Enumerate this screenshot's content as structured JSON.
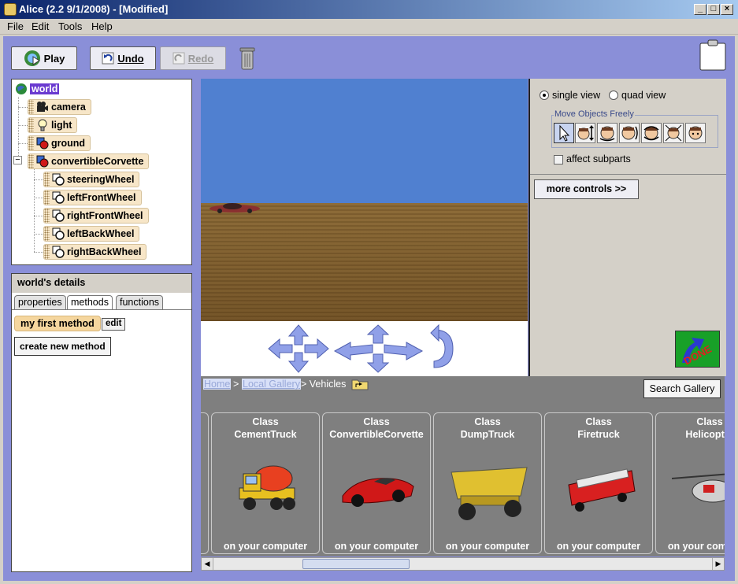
{
  "window": {
    "title": "Alice (2.2  9/1/2008) - [Modified]",
    "min_glyph": "_",
    "max_glyph": "□",
    "close_glyph": "×"
  },
  "menu": [
    "File",
    "Edit",
    "Tools",
    "Help"
  ],
  "toolbar": {
    "play_label": "Play",
    "undo_label": "Undo",
    "redo_label": "Redo"
  },
  "tree": {
    "root": "world",
    "items": [
      "camera",
      "light",
      "ground",
      "convertibleCorvette"
    ],
    "expander": "−",
    "children": [
      "steeringWheel",
      "leftFrontWheel",
      "rightFrontWheel",
      "leftBackWheel",
      "rightBackWheel"
    ]
  },
  "details": {
    "title": "world's details",
    "tabs": [
      "properties",
      "methods",
      "functions"
    ],
    "active_tab": "methods",
    "method_name": "my first method",
    "edit_label": "edit",
    "create_label": "create new method"
  },
  "view_controls": {
    "single_view": "single view",
    "quad_view": "quad view",
    "selected_view": "single view",
    "move_group": "Move Objects Freely",
    "affect_subparts": "affect subparts",
    "affect_subparts_checked": false,
    "more_controls": "more controls  >>",
    "done_label": "DONE"
  },
  "gallery": {
    "breadcrumb_home": "Home",
    "breadcrumb_sep": ">",
    "breadcrumb_local": "Local Gallery",
    "breadcrumb_current": "> Vehicles",
    "search_label": "Search Gallery",
    "class_word": "Class",
    "items": [
      {
        "name": "CementTruck",
        "location": "on your computer",
        "color": "#e8c020"
      },
      {
        "name": "ConvertibleCorvette",
        "location": "on your computer",
        "color": "#d01818"
      },
      {
        "name": "DumpTruck",
        "location": "on your computer",
        "color": "#e0c030"
      },
      {
        "name": "Firetruck",
        "location": "on your computer",
        "color": "#d82020"
      },
      {
        "name": "Helicopter",
        "location": "on your computer",
        "color": "#d0d0d0"
      }
    ],
    "scroll_left": "◀",
    "scroll_right": "▶"
  }
}
